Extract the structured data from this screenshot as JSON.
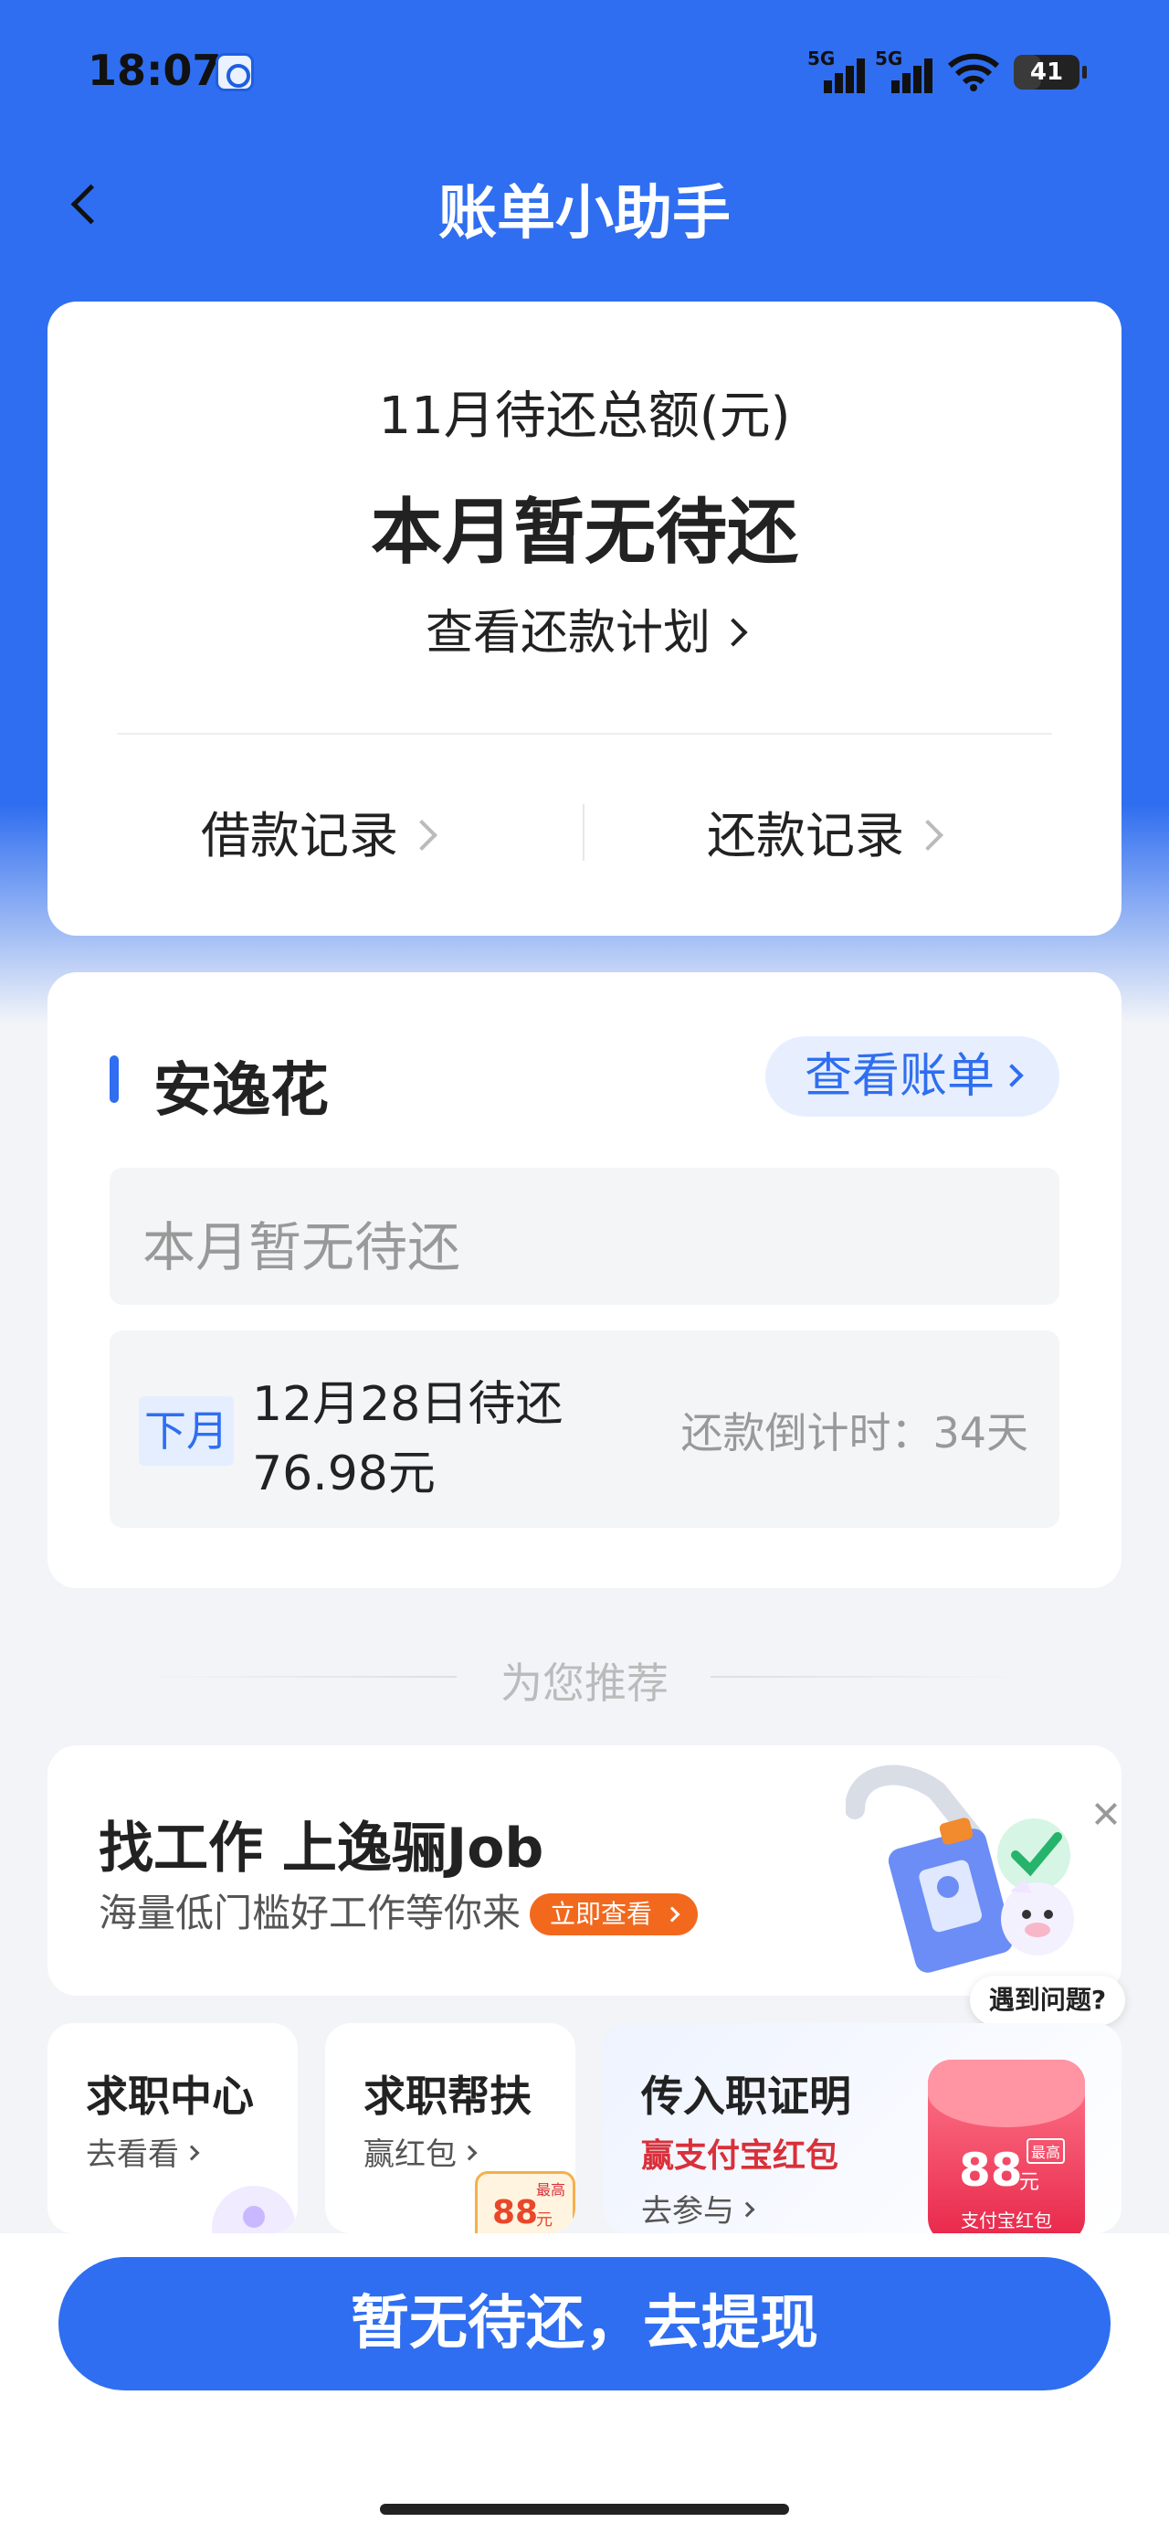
{
  "status_bar": {
    "time": "18:07",
    "network_1": "5G",
    "network_2": "5G",
    "battery": "41"
  },
  "header": {
    "title": "账单小助手",
    "back_icon": "chevron-left-icon"
  },
  "summary": {
    "label": "11月待还总额(元)",
    "amount": "本月暂无待还",
    "plan_link": "查看还款计划",
    "borrow_records": "借款记录",
    "repay_records": "还款记录"
  },
  "product_card": {
    "name": "安逸花",
    "view_bill": "查看账单",
    "this_month_status": "本月暂无待还",
    "next_tag": "下月",
    "next_due_date": "12月28日待还",
    "next_due_amount": "76.98元",
    "countdown": "还款倒计时：34天"
  },
  "recommend": {
    "title": "为您推荐"
  },
  "job_banner": {
    "title": "找工作 上逸骊Job",
    "subtitle": "海量低门槛好工作等你来",
    "cta": "立即查看",
    "help": "遇到问题?"
  },
  "mini_cards": [
    {
      "title": "求职中心",
      "sub": "去看看"
    },
    {
      "title": "求职帮扶",
      "sub": "赢红包",
      "badge_value": "88",
      "badge_unit": "元",
      "badge_tag": "最高"
    },
    {
      "title": "传入职证明",
      "highlight": "赢支付宝红包",
      "sub": "去参与",
      "badge_value": "88",
      "badge_unit": "元",
      "badge_tag": "最高",
      "badge_caption": "支付宝红包"
    }
  ],
  "bottom": {
    "cta": "暂无待还，去提现"
  },
  "colors": {
    "primary": "#2f6ef0",
    "accent_orange": "#f2691e",
    "red": "#d9303a",
    "background": "#f2f4f8"
  }
}
